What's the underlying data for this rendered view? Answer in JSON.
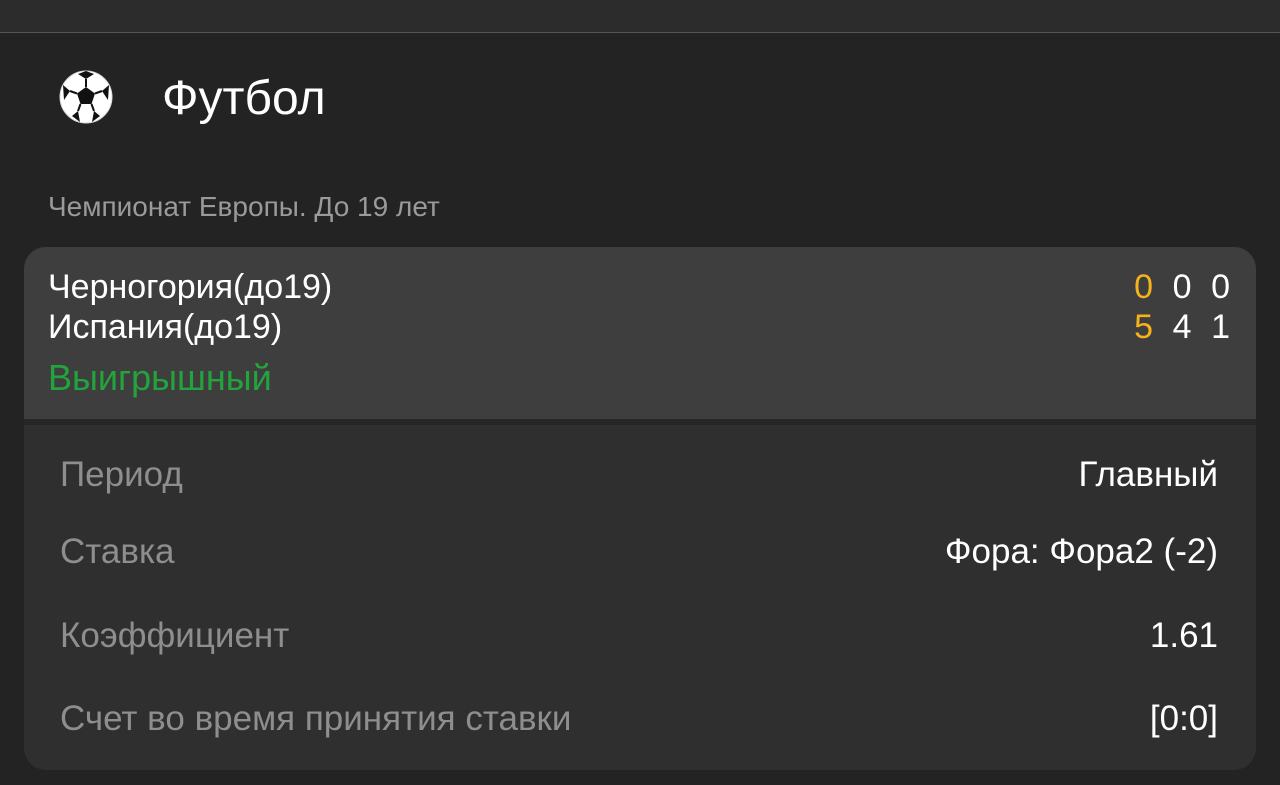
{
  "header": {
    "sport_icon": "soccer-ball-icon",
    "sport_title": "Футбол"
  },
  "league": "Чемпионат Европы. До 19 лет",
  "match": {
    "team1": "Черногория(до19)",
    "team2": "Испания(до19)",
    "status": "Выигрышный",
    "scores_team1": [
      "0",
      "0",
      "0"
    ],
    "scores_team2": [
      "5",
      "4",
      "1"
    ]
  },
  "details": [
    {
      "label": "Период",
      "value": "Главный"
    },
    {
      "label": "Ставка",
      "value": "Фора: Фора2 (-2)"
    },
    {
      "label": "Коэффициент",
      "value": "1.61"
    },
    {
      "label": "Счет во время принятия ставки",
      "value": "[0:0]"
    }
  ],
  "colors": {
    "background": "#232323",
    "card": "#2f2f2f",
    "match_panel": "#3e3e3e",
    "win_status": "#23a33c",
    "main_score": "#f4b21b",
    "muted_text": "#8e8e8e"
  }
}
